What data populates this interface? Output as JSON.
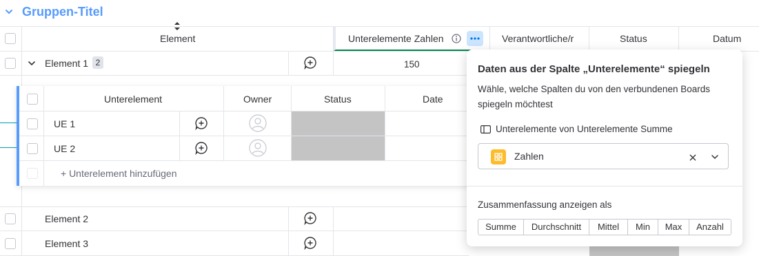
{
  "group": {
    "title": "Gruppen-Titel"
  },
  "columns": {
    "element": "Element",
    "subitems_numbers": "Unterelemente Zahlen",
    "owner": "Verantwortliche/r",
    "status": "Status",
    "date": "Datum"
  },
  "rows": [
    {
      "name": "Element 1",
      "badge": "2",
      "value": "150"
    },
    {
      "name": "Element 2",
      "value": ""
    },
    {
      "name": "Element 3",
      "value": ""
    }
  ],
  "subitems": {
    "columns": {
      "name": "Unterelement",
      "owner": "Owner",
      "status": "Status",
      "date": "Date"
    },
    "items": [
      {
        "name": "UE 1"
      },
      {
        "name": "UE 2"
      }
    ],
    "add_label": "+ Unterelement hinzufügen"
  },
  "popover": {
    "title": "Daten aus der Spalte „Unterelemente“ spiegeln",
    "description_line1": "Wähle, welche Spalten du von den verbundenen Boards",
    "description_line2": "spiegeln möchtest",
    "source_label": "Unterelemente von Unterelemente Summe",
    "selected_column": "Zahlen",
    "summary_label": "Zusammenfassung anzeigen als",
    "summary_options": [
      "Summe",
      "Durchschnitt",
      "Mittel",
      "Min",
      "Max",
      "Anzahl"
    ]
  },
  "colors": {
    "accent": "#579bfc",
    "header_active": "#00854d",
    "gray_status": "#c4c4c4",
    "zahlen_icon": "#fdbc2c"
  },
  "icons": [
    "chevron-down-icon",
    "sort-icon",
    "info-icon",
    "more-icon",
    "add-update-icon",
    "person-icon",
    "board-icon",
    "close-icon"
  ]
}
